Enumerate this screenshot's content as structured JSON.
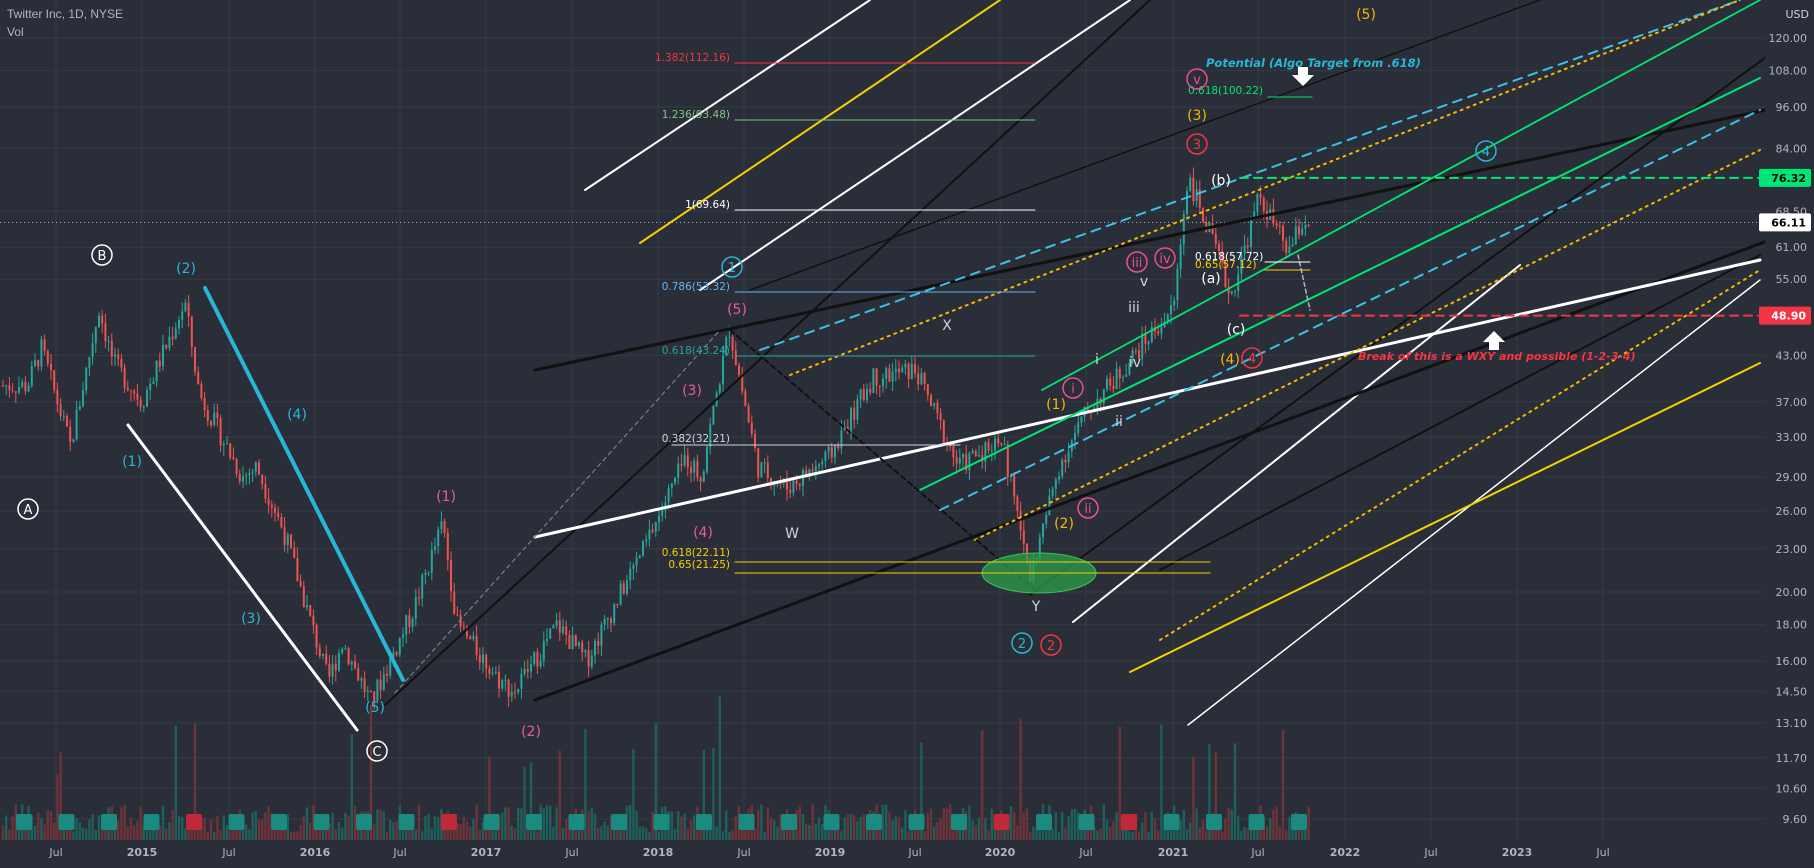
{
  "header": {
    "symbol_line": "Twitter Inc, 1D, NYSE",
    "volume_label": "Vol"
  },
  "axis": {
    "currency": "USD",
    "scale": "log",
    "y_ticks": [
      "120.00",
      "108.00",
      "96.00",
      "84.00",
      "68.50",
      "61.00",
      "55.00",
      "43.00",
      "37.00",
      "33.00",
      "29.00",
      "26.00",
      "23.00",
      "20.00",
      "18.00",
      "16.00",
      "14.50",
      "13.10",
      "11.70",
      "10.60",
      "9.60"
    ],
    "x_ticks": [
      "Jul",
      "2015",
      "Jul",
      "2016",
      "Jul",
      "2017",
      "Jul",
      "2018",
      "Jul",
      "2019",
      "Jul",
      "2020",
      "Jul",
      "2021",
      "Jul",
      "2022",
      "Jul",
      "2023",
      "Jul"
    ],
    "price_tags": [
      {
        "value": "76.32",
        "color": "#00e676",
        "text_color": "#000000"
      },
      {
        "value": "66.11",
        "color": "#ffffff",
        "text_color": "#000000"
      },
      {
        "value": "48.90",
        "color": "#f23645",
        "text_color": "#ffffff"
      }
    ]
  },
  "fib_levels": [
    {
      "label": "1.382(112.16)",
      "color": "#f23645"
    },
    {
      "label": "1.236(93.48)",
      "color": "#81c784"
    },
    {
      "label": "1(69.64)",
      "color": "#ffffff"
    },
    {
      "label": "0.786(53.32)",
      "color": "#64b5f6"
    },
    {
      "label": "0.618(43.24)",
      "color": "#26a69a"
    },
    {
      "label": "0.382(32.21)",
      "color": "#d1d4dc"
    },
    {
      "label": "0.618(22.11)",
      "color": "#f5d000"
    },
    {
      "label": "0.65(21.25)",
      "color": "#f5d000"
    },
    {
      "label": "0.618(100.22)",
      "color": "#00e676"
    },
    {
      "label": "0.618(57.72)",
      "color": "#ffffff"
    },
    {
      "label": "0.65(57.12)",
      "color": "#f5d000"
    }
  ],
  "annotations": {
    "potential_target": "Potential (Algo Target from .618)",
    "break_note": "Break of this is a WXY and possible (1-2-3-4)"
  },
  "wave_labels": [
    {
      "text": "A",
      "color": "#ffffff"
    },
    {
      "text": "B",
      "color": "#ffffff"
    },
    {
      "text": "C",
      "color": "#ffffff"
    },
    {
      "text": "(1)",
      "color": "#29b6d6"
    },
    {
      "text": "(2)",
      "color": "#29b6d6"
    },
    {
      "text": "(3)",
      "color": "#29b6d6"
    },
    {
      "text": "(4)",
      "color": "#29b6d6"
    },
    {
      "text": "(5)",
      "color": "#29b6d6"
    },
    {
      "text": "(1)",
      "color": "#ec5a9b"
    },
    {
      "text": "(2)",
      "color": "#ec5a9b"
    },
    {
      "text": "(3)",
      "color": "#ec5a9b"
    },
    {
      "text": "(4)",
      "color": "#ec5a9b"
    },
    {
      "text": "(5)",
      "color": "#ec5a9b"
    },
    {
      "text": "W",
      "color": "#d1d4dc"
    },
    {
      "text": "X",
      "color": "#d1d4dc"
    },
    {
      "text": "Y",
      "color": "#d1d4dc"
    },
    {
      "text": "2",
      "color": "#29b6d6"
    },
    {
      "text": "2",
      "color": "#f23645"
    },
    {
      "text": "1",
      "color": "#29b6d6"
    },
    {
      "text": "(1)",
      "color": "#f5b800"
    },
    {
      "text": "(2)",
      "color": "#f5b800"
    },
    {
      "text": "(3)",
      "color": "#f5b800"
    },
    {
      "text": "(4)",
      "color": "#f5b800"
    },
    {
      "text": "(5)",
      "color": "#f5b800"
    },
    {
      "text": "i",
      "color": "#ec4f8f"
    },
    {
      "text": "ii",
      "color": "#ec4f8f"
    },
    {
      "text": "iii",
      "color": "#ec4f8f"
    },
    {
      "text": "iv",
      "color": "#ec4f8f"
    },
    {
      "text": "v",
      "color": "#ec4f8f"
    },
    {
      "text": "i",
      "color": "#d1d4dc"
    },
    {
      "text": "ii",
      "color": "#d1d4dc"
    },
    {
      "text": "iii",
      "color": "#d1d4dc"
    },
    {
      "text": "iv",
      "color": "#d1d4dc"
    },
    {
      "text": "v",
      "color": "#d1d4dc"
    },
    {
      "text": "(a)",
      "color": "#ffffff"
    },
    {
      "text": "(b)",
      "color": "#ffffff"
    },
    {
      "text": "(c)",
      "color": "#ffffff"
    },
    {
      "text": "4",
      "color": "#29b6d6"
    },
    {
      "text": "3",
      "color": "#f23645"
    },
    {
      "text": "4",
      "color": "#f23645"
    }
  ],
  "chart_data": {
    "type": "candlestick",
    "title": "Twitter Inc, 1D, NYSE",
    "y_scale": "log",
    "last_price": 66.11,
    "marked_levels": [
      76.32,
      66.11,
      48.9
    ],
    "x_range": [
      "2014-05",
      "2023-09"
    ],
    "ylim": [
      9.6,
      125
    ],
    "price_path": [
      {
        "date": "2014-05",
        "close": 39
      },
      {
        "date": "2014-06",
        "close": 44
      },
      {
        "date": "2014-08",
        "close": 32
      },
      {
        "date": "2014-10",
        "close": 50
      },
      {
        "date": "2014-11",
        "close": 42
      },
      {
        "date": "2015-01",
        "close": 37
      },
      {
        "date": "2015-04",
        "close": 51
      },
      {
        "date": "2015-05",
        "close": 38
      },
      {
        "date": "2015-08",
        "close": 29
      },
      {
        "date": "2015-09",
        "close": 30
      },
      {
        "date": "2015-11",
        "close": 24
      },
      {
        "date": "2016-02",
        "close": 15
      },
      {
        "date": "2016-03",
        "close": 17
      },
      {
        "date": "2016-05",
        "close": 14
      },
      {
        "date": "2016-08",
        "close": 19
      },
      {
        "date": "2016-10",
        "close": 25
      },
      {
        "date": "2016-11",
        "close": 18
      },
      {
        "date": "2017-02",
        "close": 15
      },
      {
        "date": "2017-03",
        "close": 14.5
      },
      {
        "date": "2017-06",
        "close": 18
      },
      {
        "date": "2017-08",
        "close": 16
      },
      {
        "date": "2017-12",
        "close": 23
      },
      {
        "date": "2018-03",
        "close": 31
      },
      {
        "date": "2018-04",
        "close": 29
      },
      {
        "date": "2018-06",
        "close": 47
      },
      {
        "date": "2018-08",
        "close": 30
      },
      {
        "date": "2018-10",
        "close": 28
      },
      {
        "date": "2019-01",
        "close": 31
      },
      {
        "date": "2019-04",
        "close": 40
      },
      {
        "date": "2019-07",
        "close": 41
      },
      {
        "date": "2019-10",
        "close": 30
      },
      {
        "date": "2020-01",
        "close": 33
      },
      {
        "date": "2020-03",
        "close": 21
      },
      {
        "date": "2020-05",
        "close": 30
      },
      {
        "date": "2020-07",
        "close": 36
      },
      {
        "date": "2020-09",
        "close": 40
      },
      {
        "date": "2020-11",
        "close": 45
      },
      {
        "date": "2021-01",
        "close": 50
      },
      {
        "date": "2021-02",
        "close": 77
      },
      {
        "date": "2021-04",
        "close": 60
      },
      {
        "date": "2021-05",
        "close": 52
      },
      {
        "date": "2021-07",
        "close": 72
      },
      {
        "date": "2021-09",
        "close": 60
      },
      {
        "date": "2021-10",
        "close": 66.11
      }
    ]
  }
}
